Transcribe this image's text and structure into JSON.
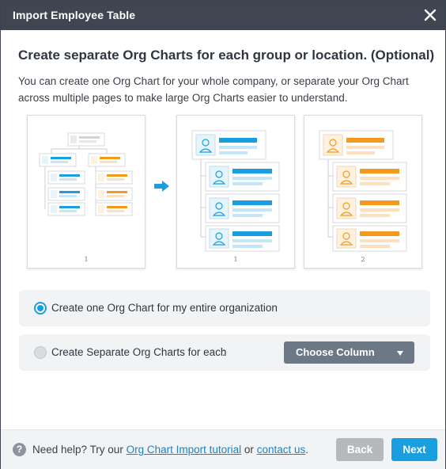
{
  "dialog": {
    "title": "Import Employee Table",
    "close_icon": "close-icon"
  },
  "content": {
    "heading": "Create separate Org Charts for each group or location. (Optional)",
    "description": "You can create one Org Chart for your whole company, or separate your Org Chart across multiple pages to make large Org Charts easier to understand."
  },
  "illustration": {
    "page_numbers": [
      "1",
      "1",
      "2"
    ],
    "colors": {
      "blue": "#1a9ee0",
      "blue_light": "#c5e6f7",
      "orange": "#f39a1e",
      "orange_light": "#fde1bf",
      "gray": "#d0d4d9"
    },
    "arrow_icon": "arrow-right-icon"
  },
  "options": [
    {
      "label": "Create one Org Chart for my entire organization",
      "selected": true
    },
    {
      "label": "Create Separate Org Charts for each",
      "selected": false,
      "suffix": ":",
      "select_value": "Choose Column"
    }
  ],
  "footer": {
    "help_prefix": "Need help? Try our",
    "tutorial_link": "Org Chart Import tutorial",
    "or_text": "or",
    "contact_link": "contact us",
    "period": ".",
    "back_label": "Back",
    "next_label": "Next"
  }
}
